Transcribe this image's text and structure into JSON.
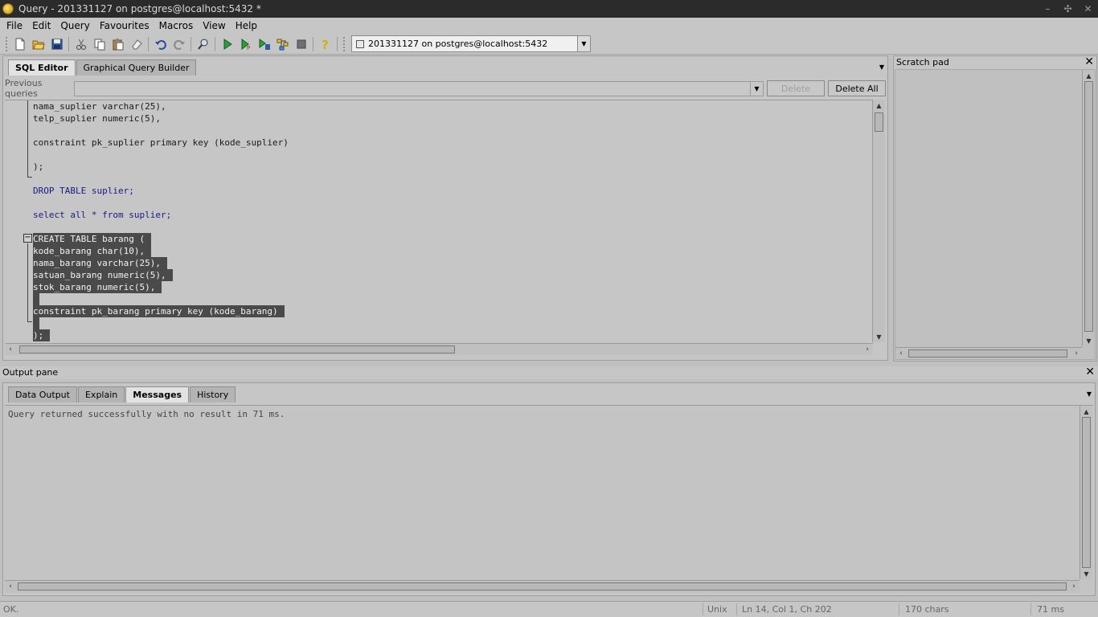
{
  "window": {
    "title": "Query - 201331127 on postgres@localhost:5432 *",
    "minimize": "–",
    "restore": "✣",
    "close": "✕"
  },
  "menu": [
    "File",
    "Edit",
    "Query",
    "Favourites",
    "Macros",
    "View",
    "Help"
  ],
  "toolbar": {
    "buttons": [
      "new-icon",
      "open-icon",
      "save-icon",
      "cut-icon",
      "copy-icon",
      "paste-icon",
      "clear-icon",
      "undo-icon",
      "redo-icon",
      "find-icon",
      "execute-icon",
      "execute-pgscript-icon",
      "execute-to-file-icon",
      "explain-icon",
      "cancel-icon",
      "help-icon"
    ],
    "connection": "201331127 on postgres@localhost:5432"
  },
  "editor": {
    "tabs": [
      "SQL Editor",
      "Graphical Query Builder"
    ],
    "previous_queries_label": "Previous queries",
    "delete_label": "Delete",
    "delete_all_label": "Delete All",
    "lines": [
      "nama_suplier varchar(25),",
      "telp_suplier numeric(5),",
      "",
      "constraint pk_suplier primary key (kode_suplier)",
      "",
      ");",
      "",
      "DROP TABLE suplier;",
      "",
      "select all * from suplier;",
      "",
      "CREATE TABLE barang (",
      "kode_barang char(10),",
      "nama_barang varchar(25),",
      "satuan_barang numeric(5),",
      "stok_barang numeric(5),",
      "",
      "constraint pk_barang primary key (kode_barang)",
      "",
      ");"
    ],
    "fold_toggle": "−"
  },
  "scratch_pad": {
    "title": "Scratch pad",
    "close": "✕"
  },
  "output": {
    "title": "Output pane",
    "close": "✕",
    "tabs": [
      "Data Output",
      "Explain",
      "Messages",
      "History"
    ],
    "active_tab": "Messages",
    "message": "Query returned successfully with no result in 71 ms."
  },
  "status": {
    "state": "OK.",
    "line_endings": "Unix",
    "position": "Ln 14, Col 1, Ch 202",
    "chars": "170 chars",
    "time": "71 ms"
  },
  "colors": {
    "titlebar": "#2b2b2b",
    "background": "#c6c6c6",
    "selection": "#4a4a4a",
    "keyword": "#1a1a8a"
  }
}
